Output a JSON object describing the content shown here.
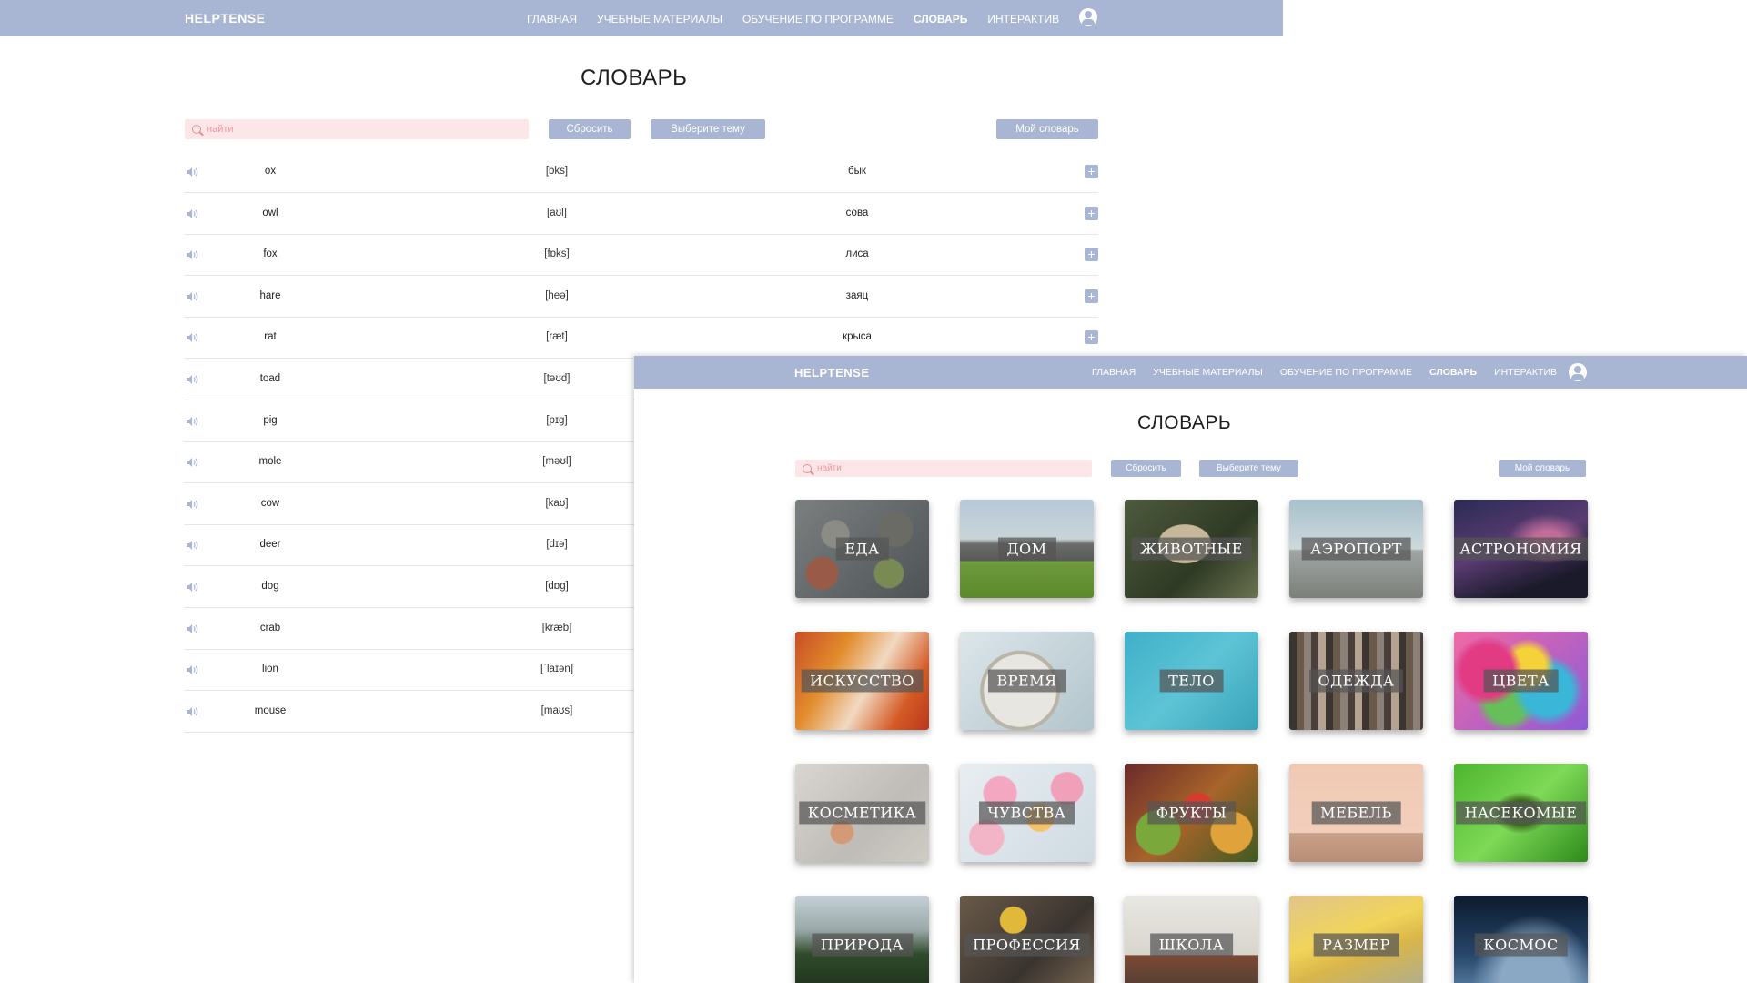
{
  "brand": "HELPTENSE",
  "nav": [
    "ГЛАВНАЯ",
    "УЧЕБНЫЕ МАТЕРИАЛЫ",
    "ОБУЧЕНИЕ ПО ПРОГРАММЕ",
    "СЛОВАРЬ",
    "ИНТЕРАКТИВ"
  ],
  "nav_active": "СЛОВАРЬ",
  "page_title": "СЛОВАРЬ",
  "search_placeholder": "найти",
  "buttons": {
    "reset": "Сбросить",
    "choose_topic": "Выберите тему",
    "my_dictionary": "Мой словарь"
  },
  "words": [
    {
      "en": "ox",
      "transcription": "[ɒks]",
      "ru": "бык"
    },
    {
      "en": "owl",
      "transcription": "[aʊl]",
      "ru": "сова"
    },
    {
      "en": "fox",
      "transcription": "[fɒks]",
      "ru": "лиса"
    },
    {
      "en": "hare",
      "transcription": "[heə]",
      "ru": "заяц"
    },
    {
      "en": "rat",
      "transcription": "[ræt]",
      "ru": "крыса"
    },
    {
      "en": "toad",
      "transcription": "[təʊd]",
      "ru": ""
    },
    {
      "en": "pig",
      "transcription": "[pɪɡ]",
      "ru": ""
    },
    {
      "en": "mole",
      "transcription": "[məʊl]",
      "ru": ""
    },
    {
      "en": "cow",
      "transcription": "[kaʊ]",
      "ru": ""
    },
    {
      "en": "deer",
      "transcription": "[dɪə]",
      "ru": ""
    },
    {
      "en": "dog",
      "transcription": "[dɒɡ]",
      "ru": ""
    },
    {
      "en": "crab",
      "transcription": "[kræb]",
      "ru": ""
    },
    {
      "en": "lion",
      "transcription": "[ˈlaɪən]",
      "ru": ""
    },
    {
      "en": "mouse",
      "transcription": "[maʊs]",
      "ru": ""
    }
  ],
  "topics": [
    "ЕДА",
    "ДОМ",
    "ЖИВОТНЫЕ",
    "АЭРОПОРТ",
    "АСТРОНОМИЯ",
    "ИСКУССТВО",
    "ВРЕМЯ",
    "ТЕЛО",
    "ОДЕЖДА",
    "ЦВЕТА",
    "КОСМЕТИКА",
    "ЧУВСТВА",
    "ФРУКТЫ",
    "МЕБЕЛЬ",
    "НАСЕКОМЫЕ",
    "ПРИРОДА",
    "ПРОФЕССИЯ",
    "ШКОЛА",
    "РАЗМЕР",
    "КОСМОС"
  ],
  "topic_icons": [
    "food-image",
    "home-image",
    "animals-image",
    "airport-image",
    "astronomy-image",
    "art-image",
    "time-image",
    "body-image",
    "clothes-image",
    "colors-image",
    "cosmetics-image",
    "feelings-image",
    "fruits-image",
    "furniture-image",
    "insects-image",
    "nature-image",
    "profession-image",
    "school-image",
    "size-image",
    "space-image"
  ],
  "colors": {
    "nav": "#a9b6d3",
    "button": "#a9b6d3",
    "search_bg": "#fde6e8",
    "search_text": "#ec9aa2"
  }
}
